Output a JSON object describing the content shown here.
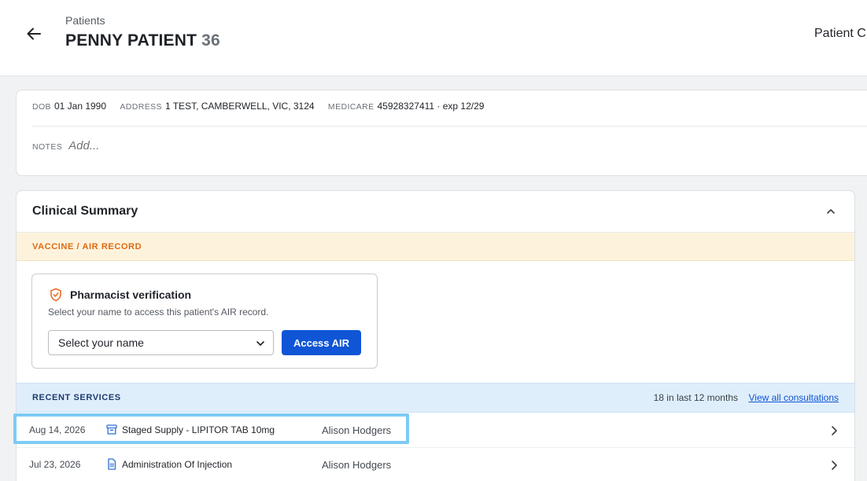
{
  "header": {
    "breadcrumb": "Patients",
    "patient_name": "PENNY PATIENT",
    "patient_number": "36",
    "top_right_text": "Patient C"
  },
  "patient_info": {
    "dob_label": "DOB",
    "dob": "01 Jan 1990",
    "address_label": "ADDRESS",
    "address": "1 TEST, CAMBERWELL, VIC, 3124",
    "medicare_label": "MEDICARE",
    "medicare": "45928327411 · exp 12/29",
    "notes_label": "NOTES",
    "notes_placeholder": "Add..."
  },
  "clinical_summary": {
    "title": "Clinical Summary",
    "vaccine_label": "VACCINE / AIR RECORD",
    "verification": {
      "title": "Pharmacist verification",
      "description": "Select your name to access this patient's AIR record.",
      "select_value": "Select your name",
      "button_label": "Access AIR"
    },
    "recent_services": {
      "label": "RECENT SERVICES",
      "count_text": "18 in last 12 months",
      "link_text": "View all consultations",
      "rows": [
        {
          "date": "Aug 14, 2026",
          "name": "Staged Supply - LIPITOR TAB 10mg",
          "person": "Alison Hodgers",
          "icon": "archive-box-icon"
        },
        {
          "date": "Jul 23, 2026",
          "name": "Administration Of Injection",
          "person": "Alison Hodgers",
          "icon": "document-icon"
        }
      ]
    }
  },
  "colors": {
    "primary_button": "#0f55d6",
    "vaccine_band": "#fdf3dd",
    "vaccine_text": "#e06a12",
    "services_band": "#dfeefb",
    "highlight_border": "#7ccbf5"
  }
}
